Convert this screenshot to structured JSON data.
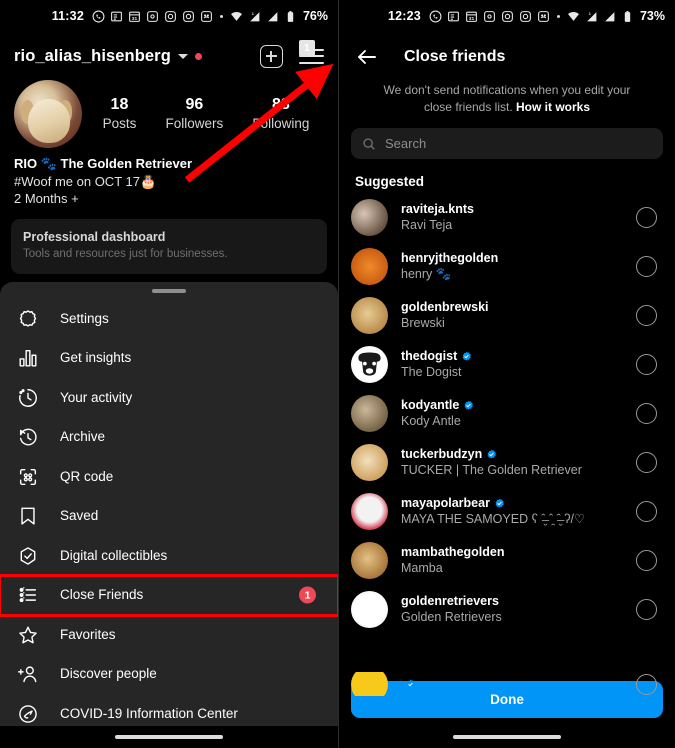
{
  "left": {
    "statusbar": {
      "time": "11:32",
      "battery": "76%",
      "icons": [
        "whatsapp-icon",
        "news-icon",
        "calendar-icon",
        "app-icon",
        "instagram-icon",
        "instagram-icon",
        "app-icon",
        "dot-icon",
        "wifi-icon",
        "signal-icon",
        "signal-icon",
        "battery-icon"
      ]
    },
    "profile": {
      "username": "rio_alias_hisenberg",
      "stats": [
        {
          "num": "18",
          "label": "Posts"
        },
        {
          "num": "96",
          "label": "Followers"
        },
        {
          "num": "88",
          "label": "Following"
        }
      ],
      "bio_title": "RIO 🐾 The Golden Retriever",
      "bio_line2": "#Woof me on OCT 17🎂",
      "bio_line3": "2 Months +",
      "dashboard_title": "Professional dashboard",
      "dashboard_sub": "Tools and resources just for businesses."
    },
    "menu": {
      "items": [
        {
          "label": "Settings",
          "icon": "settings-gear-icon",
          "badge": ""
        },
        {
          "label": "Get insights",
          "icon": "bar-chart-icon",
          "badge": ""
        },
        {
          "label": "Your activity",
          "icon": "clock-activity-icon",
          "badge": ""
        },
        {
          "label": "Archive",
          "icon": "archive-clock-icon",
          "badge": ""
        },
        {
          "label": "QR code",
          "icon": "qr-code-icon",
          "badge": ""
        },
        {
          "label": "Saved",
          "icon": "bookmark-icon",
          "badge": ""
        },
        {
          "label": "Digital collectibles",
          "icon": "check-hexagon-icon",
          "badge": ""
        },
        {
          "label": "Close Friends",
          "icon": "close-friends-list-icon",
          "badge": "1"
        },
        {
          "label": "Favorites",
          "icon": "star-icon",
          "badge": ""
        },
        {
          "label": "Discover people",
          "icon": "add-person-icon",
          "badge": ""
        },
        {
          "label": "COVID-19 Information Center",
          "icon": "covid-info-icon",
          "badge": ""
        }
      ]
    },
    "header_badge": "1"
  },
  "right": {
    "statusbar": {
      "time": "12:23",
      "battery": "73%"
    },
    "title": "Close friends",
    "description_plain": "We don't send notifications when you edit your close friends list. ",
    "description_link": "How it works",
    "search_placeholder": "Search",
    "section_title": "Suggested",
    "suggestions": [
      {
        "username": "raviteja.knts",
        "name": "Ravi Teja",
        "verified": false
      },
      {
        "username": "henryjthegolden",
        "name": "henry 🐾",
        "verified": false
      },
      {
        "username": "goldenbrewski",
        "name": "Brewski",
        "verified": false
      },
      {
        "username": "thedogist",
        "name": "The Dogist",
        "verified": true
      },
      {
        "username": "kodyantle",
        "name": "Kody Antle",
        "verified": true
      },
      {
        "username": "tuckerbudzyn",
        "name": "TUCKER | The Golden Retriever",
        "verified": true
      },
      {
        "username": "mayapolarbear",
        "name": "MAYA THE SAMOYED ʕ ˆ̶̮ ˆ̯ ˆ̶̮ ʔ/♡",
        "verified": true
      },
      {
        "username": "mambathegolden",
        "name": "Mamba",
        "verified": false
      },
      {
        "username": "goldenretrievers",
        "name": "Golden Retrievers",
        "verified": false
      }
    ],
    "done_label": "Done"
  },
  "colors": {
    "accent_blue": "#0095f6",
    "badge_red": "#ed4956",
    "annotation_red": "#ff0000",
    "sheet_bg": "#262626",
    "page_bg": "#000000"
  }
}
